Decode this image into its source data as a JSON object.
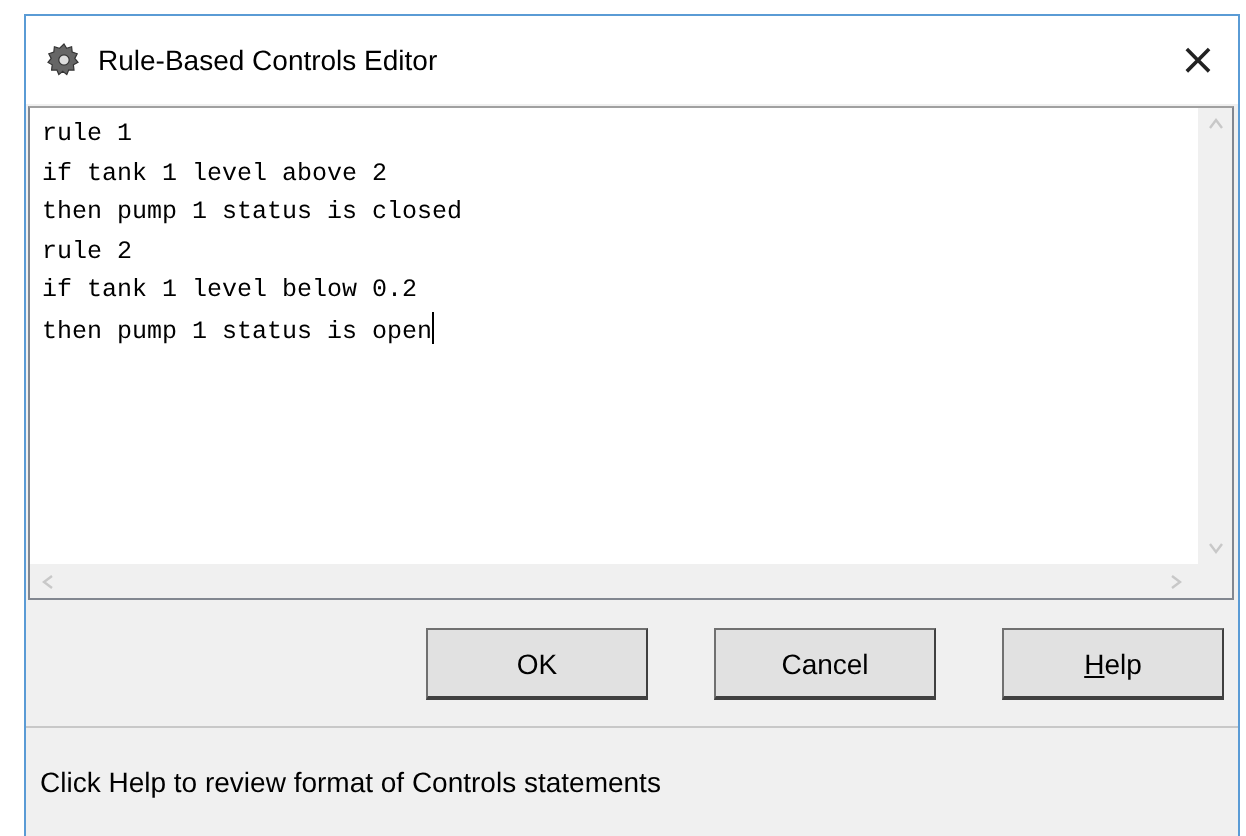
{
  "window": {
    "title": "Rule-Based Controls Editor",
    "close": "×"
  },
  "editor": {
    "lines": [
      "rule 1",
      "if tank 1 level above 2",
      "then pump 1 status is closed",
      "rule 2",
      "if tank 1 level below 0.2",
      "then pump 1 status is open"
    ],
    "caret": true
  },
  "buttons": [
    {
      "label": "OK",
      "mnemonic_underlined": false
    },
    {
      "label": "Cancel",
      "mnemonic_underlined": false
    },
    {
      "label": "Help",
      "mnemonic_underlined": true
    }
  ],
  "status_bar": "Click Help to review format of Controls statements"
}
